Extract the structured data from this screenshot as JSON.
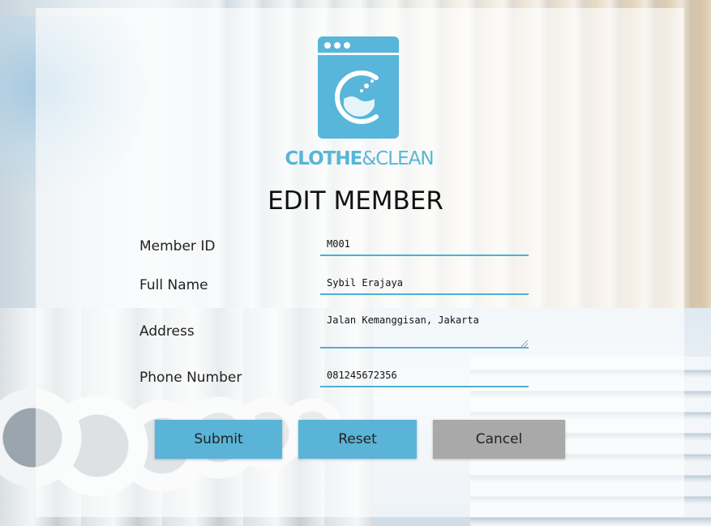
{
  "brand": {
    "name_bold": "CLOTHE",
    "name_light": "&CLEAN",
    "color": "#57b6d9"
  },
  "page": {
    "title": "EDIT MEMBER"
  },
  "form": {
    "member_id": {
      "label": "Member ID",
      "value": "M001"
    },
    "full_name": {
      "label": "Full Name",
      "value": "Sybil Erajaya"
    },
    "address": {
      "label": "Address",
      "value": "Jalan Kemanggisan, Jakarta"
    },
    "phone": {
      "label": "Phone Number",
      "value": "081245672356"
    }
  },
  "actions": {
    "submit": "Submit",
    "reset": "Reset",
    "cancel": "Cancel",
    "primary_color": "#5ab4d8",
    "secondary_color": "#a9a9a9"
  },
  "icons": {
    "logo": "washing-machine-icon",
    "resize": "resize-grip-icon"
  }
}
